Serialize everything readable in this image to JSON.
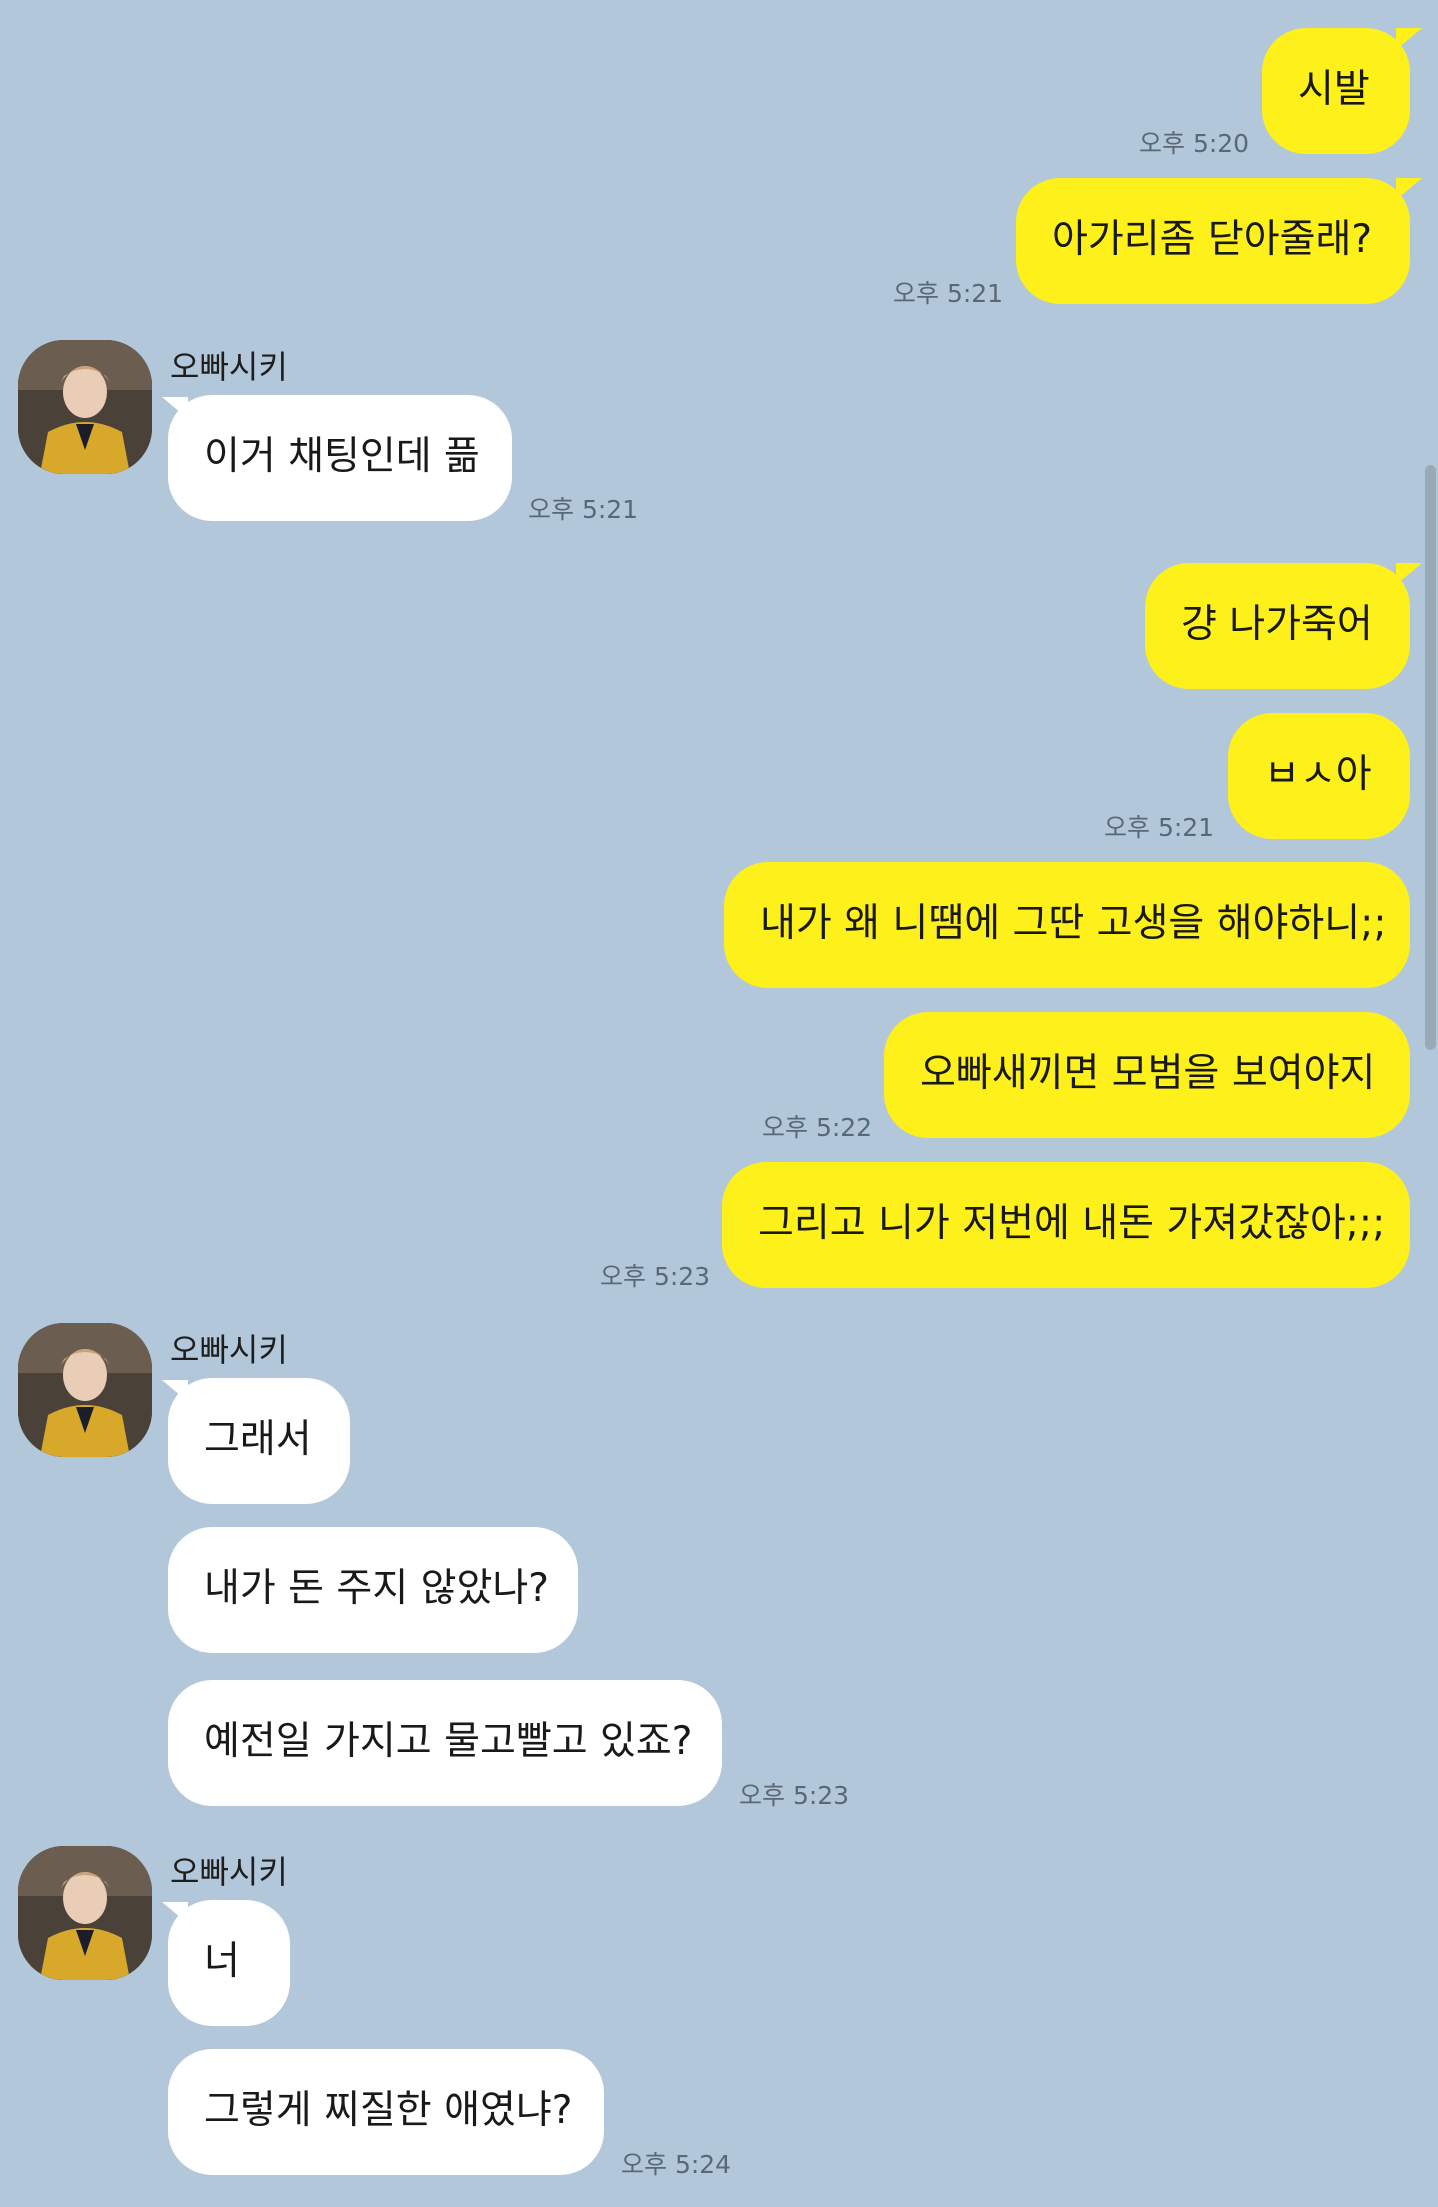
{
  "contact": {
    "name": "오빠시키"
  },
  "messages": [
    {
      "from": "me",
      "text": "시발"
    },
    {
      "from": "me",
      "text": "아가리좀 닫아줄래?"
    },
    {
      "from": "other",
      "text": "이거 채팅인데 픎"
    },
    {
      "from": "me",
      "text": "걍 나가죽어"
    },
    {
      "from": "me",
      "text": "ㅂㅅ아"
    },
    {
      "from": "me",
      "text": "내가 왜 니땜에 그딴 고생을 해야하니;;"
    },
    {
      "from": "me",
      "text": "오빠새끼면 모범을 보여야지"
    },
    {
      "from": "me",
      "text": "그리고 니가 저번에 내돈 가져갔잖아;;;"
    },
    {
      "from": "other",
      "text": "그래서"
    },
    {
      "from": "other",
      "text": "내가 돈 주지 않았나?"
    },
    {
      "from": "other",
      "text": "예전일 가지고 물고빨고 있죠?"
    },
    {
      "from": "other",
      "text": "너"
    },
    {
      "from": "other",
      "text": "그렇게 찌질한 애였냐?"
    }
  ],
  "times": [
    "오후 5:20",
    "오후 5:21",
    "오후 5:21",
    "오후 5:21",
    "오후 5:22",
    "오후 5:23",
    "오후 5:23",
    "오후 5:24"
  ],
  "colors": {
    "background": "#b2c7da",
    "my_bubble": "#fef01b",
    "their_bubble": "#ffffff"
  },
  "icons": {
    "avatar": "profile-photo"
  }
}
